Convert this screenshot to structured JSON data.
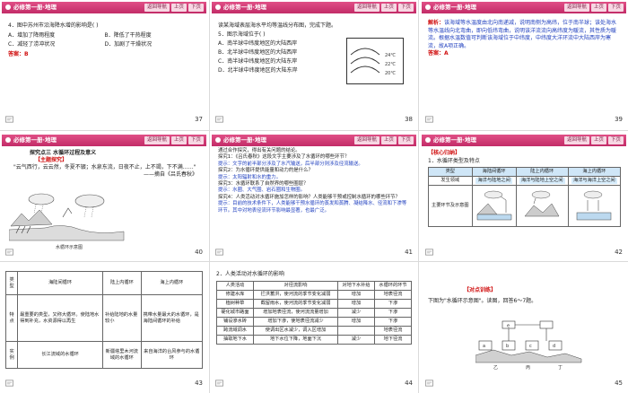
{
  "header": {
    "title": "必修第一册·地理",
    "nav_buttons": [
      "返回导航",
      "上页",
      "下页"
    ]
  },
  "slides": [
    {
      "number": "37",
      "lines": [
        "4．图中苏州市沿海降水增的影响是(    )",
        "A．增加了降雨程度",
        "B．降低了干热程度",
        "C．减轻了涝冲状况",
        "D．加剧了干燥状况"
      ],
      "answer_label": "答案：",
      "answer": "B"
    },
    {
      "number": "38",
      "intro": "读某海域表层海水平均等温线分布图，完成下题。",
      "question": "5．图示海域位于(    )",
      "options": [
        "A．南半球中纬度地区的大陆西岸",
        "B．北半球中纬度地区的大陆西岸",
        "C．南半球中纬度地区的大陆东岸",
        "D．北半球中纬度地区的大陆东岸"
      ],
      "iso_labels": [
        "24℃",
        "22℃",
        "20℃"
      ]
    },
    {
      "number": "39",
      "analysis_label": "解析：",
      "analysis": "该海域等水温度由北向南递减，说明南侧为高纬，位于南半球；该处海水等水温线向北弯曲，即向低纬弯曲，说明该洋流流向高纬度为暖流，其性质为暖流。根据水温数值可判断该海域位于中纬度，中纬度大洋环流中大陆西岸为寒流，故A项正确。",
      "answer_label": "答案：",
      "answer": "A"
    },
    {
      "number": "40",
      "heading": "探究点三  水循环过程及意义",
      "sub_heading": "【主题探究】",
      "poem": "\"云气西行，云云然，冬夏不辍；水泉东流，日夜不止，上不竭，下不满……\"",
      "source": "——摘自《吕氏春秋》",
      "figure_caption": "水循环示意图"
    },
    {
      "number": "41",
      "lines": [
        "通过合作探究，得出有关问题的结论。",
        "探究1：《吕氏春秋》这段文字主要涉及了水循环的哪些环节？",
        "提示：文字的前半部分涉及了水汽输送，后半部分则涉及径流输送。",
        "探究2：为水循环提供能量和动力的是什么？",
        "提示：太阳辐射和水的重力。",
        "探究3：水循环联系了自然界的哪些圈层？",
        "提示：水圈、大气圈、岩石圈和生物圈。",
        "探究4：人类活动对水循环施加怎样的影响？人类能够干预或控制水循环的哪些环节？",
        "提示：目前的技术条件下，人类能够干预水循环的蒸发和蒸腾、凝结降水、径流和下渗等环节。其中对地表径流环节影响最显著，也最广泛。"
      ]
    },
    {
      "number": "42",
      "heading": "【核心归纳】",
      "sub": "1．水循环类型及特点",
      "table_headers": [
        "类型",
        "海陆间循环",
        "陆上内循环",
        "海上内循环"
      ],
      "row1_label": "发生领域",
      "row1": [
        "海洋与陆地之间",
        "海洋与陆地上空之间",
        "海洋与海洋上空之间"
      ],
      "row2_label": "主要环节及示意图"
    },
    {
      "number": "43",
      "table_headers": [
        "类型",
        "海陆间循环",
        "陆上内循环",
        "海上内循环"
      ],
      "row_labels": [
        "特点",
        "实例"
      ],
      "traits": [
        "最重要的类型，又称大循环。使陆地水得到补充，水资源得以再生",
        "补给陆地的水量较小",
        "携带水量最大的水循环，是海陆间循环的补给"
      ],
      "examples": [
        "长江流域的水循环",
        "新疆塔里木河流域的水循环",
        "来自海洋的台风参与的水循环"
      ]
    },
    {
      "number": "44",
      "heading": "2．人类活动对水循环的影响",
      "table_headers": [
        "人类活动",
        "对径流影响",
        "对地下水补给",
        "水循环的环节"
      ],
      "rows": [
        [
          "修建水库",
          "拦洪蓄洪，使河流的季节变化减弱",
          "增加",
          "地表径流"
        ],
        [
          "植树种草",
          "截留雨水，使河流的季节变化减弱",
          "增加",
          "下渗"
        ],
        [
          "硬化城市路面",
          "增加地表径流，使河流流量增加",
          "减少",
          "下渗"
        ],
        [
          "铺设渗水砖",
          "增加下渗，使地表径流减少",
          "增加",
          "下渗"
        ],
        [
          "跨流域调水",
          "使调出区水减少，调入区增加",
          "",
          "地表径流"
        ],
        [
          "抽取地下水",
          "地下水位下降，地面下沉",
          "减少",
          "地下径流"
        ]
      ]
    },
    {
      "number": "45",
      "heading": "【对点训练】",
      "intro": "下图为\"水循环示意图\"。读图，回答6～7题。",
      "diagram_labels": [
        "乙",
        "丙",
        "丁",
        "a",
        "b",
        "c",
        "d",
        "e"
      ]
    }
  ]
}
